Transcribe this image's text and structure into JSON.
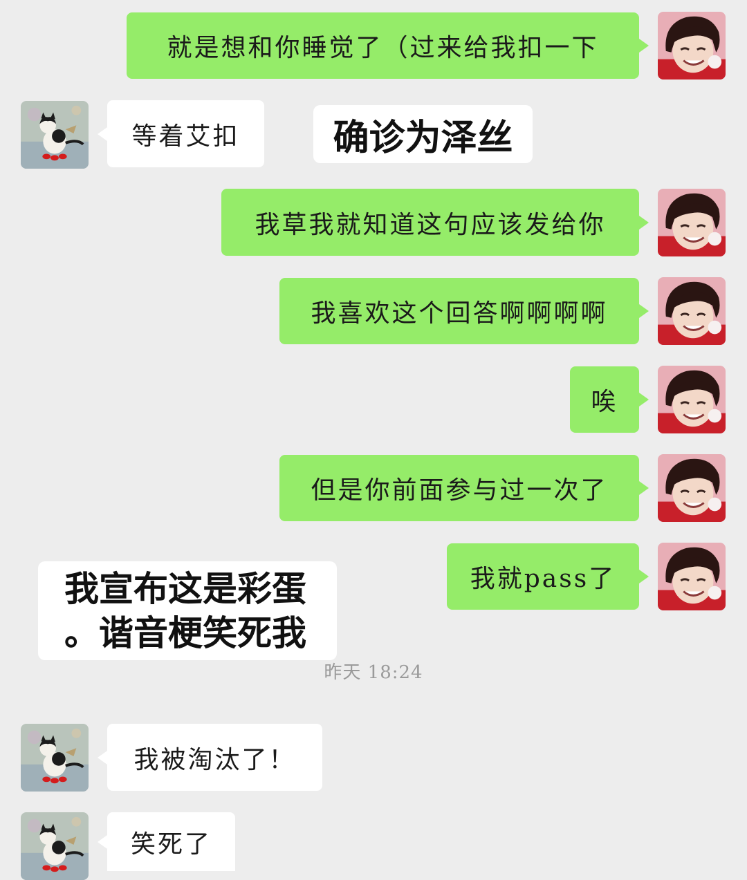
{
  "messages": [
    {
      "text": "就是想和你睡觉了（过来给我扣一下"
    },
    {
      "text": "等着艾扣"
    },
    {
      "text": "我草我就知道这句应该发给你"
    },
    {
      "text": "我喜欢这个回答啊啊啊啊"
    },
    {
      "text": "唉"
    },
    {
      "text": "但是你前面参与过一次了"
    },
    {
      "text": "我就pass了"
    },
    {
      "text": "我被淘汰了！"
    },
    {
      "text": "笑死了"
    }
  ],
  "timestamp": "昨天 18:24",
  "overlays": {
    "caption_1": "确诊为泽丝",
    "caption_2_line1": "我宣布这是彩蛋",
    "caption_2_line2": "。谐音梗笑死我"
  },
  "avatars": {
    "self": "boy-portrait-avatar",
    "other": "cat-painting-avatar"
  },
  "colors": {
    "background": "#ededed",
    "outgoing_bubble": "#95ec69",
    "incoming_bubble": "#ffffff",
    "timestamp": "#9a9a9a"
  }
}
